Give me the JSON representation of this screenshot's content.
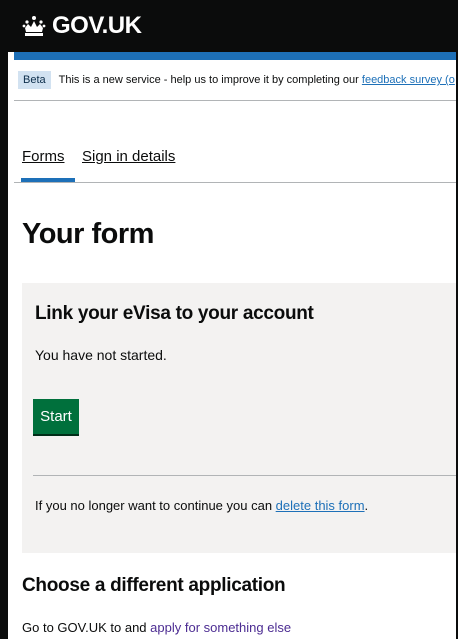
{
  "header": {
    "logo_text": "GOV.UK",
    "logo_icon": "crown-icon",
    "background": "#0b0c0c",
    "accent_bar": "#1d70b8"
  },
  "phase_banner": {
    "tag": "Beta",
    "text_before": "This is a new service - help us to improve it by completing our ",
    "link_text": "feedback survey (o"
  },
  "tabs": [
    {
      "label": "Forms",
      "active": true
    },
    {
      "label": "Sign in details",
      "active": false
    }
  ],
  "page_title": "Your form",
  "panel": {
    "heading": "Link your eVisa to your account",
    "status": "You have not started.",
    "start_button": "Start",
    "delete_text_before": "If you no longer want to continue you can ",
    "delete_link": "delete this form",
    "delete_text_after": ".",
    "background": "#f3f2f1",
    "button_color": "#00703c"
  },
  "different_application": {
    "heading": "Choose a different application",
    "text_before": "Go to GOV.UK to and ",
    "link_text": "apply for something else"
  }
}
